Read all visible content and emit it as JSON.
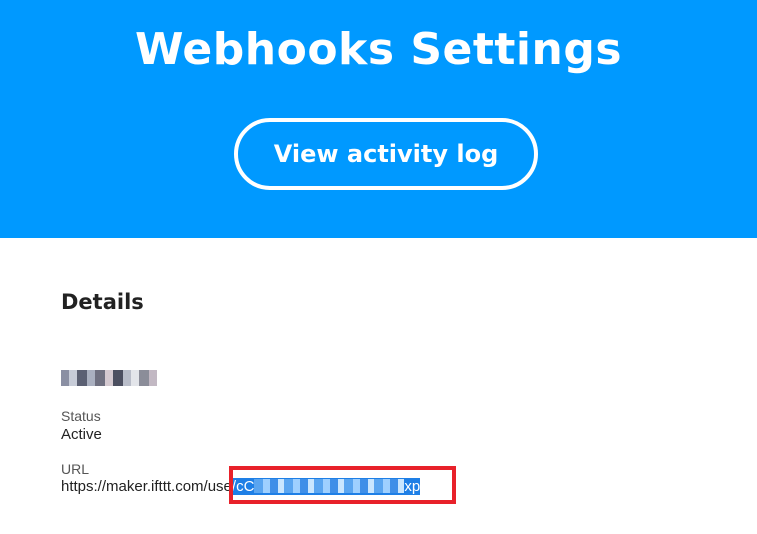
{
  "header": {
    "title": "Webhooks Settings",
    "activity_button_label": "View activity log"
  },
  "details": {
    "heading": "Details",
    "name_redacted": true,
    "status_label": "Status",
    "status_value": "Active",
    "url_label": "URL",
    "url_prefix": "https://maker.ifttt.com/use",
    "url_selected_start": "/cC",
    "url_selected_end": "xp"
  },
  "colors": {
    "header_bg": "#0099ff",
    "selection": "#1e7fe6",
    "highlight_border": "#e8212a"
  }
}
